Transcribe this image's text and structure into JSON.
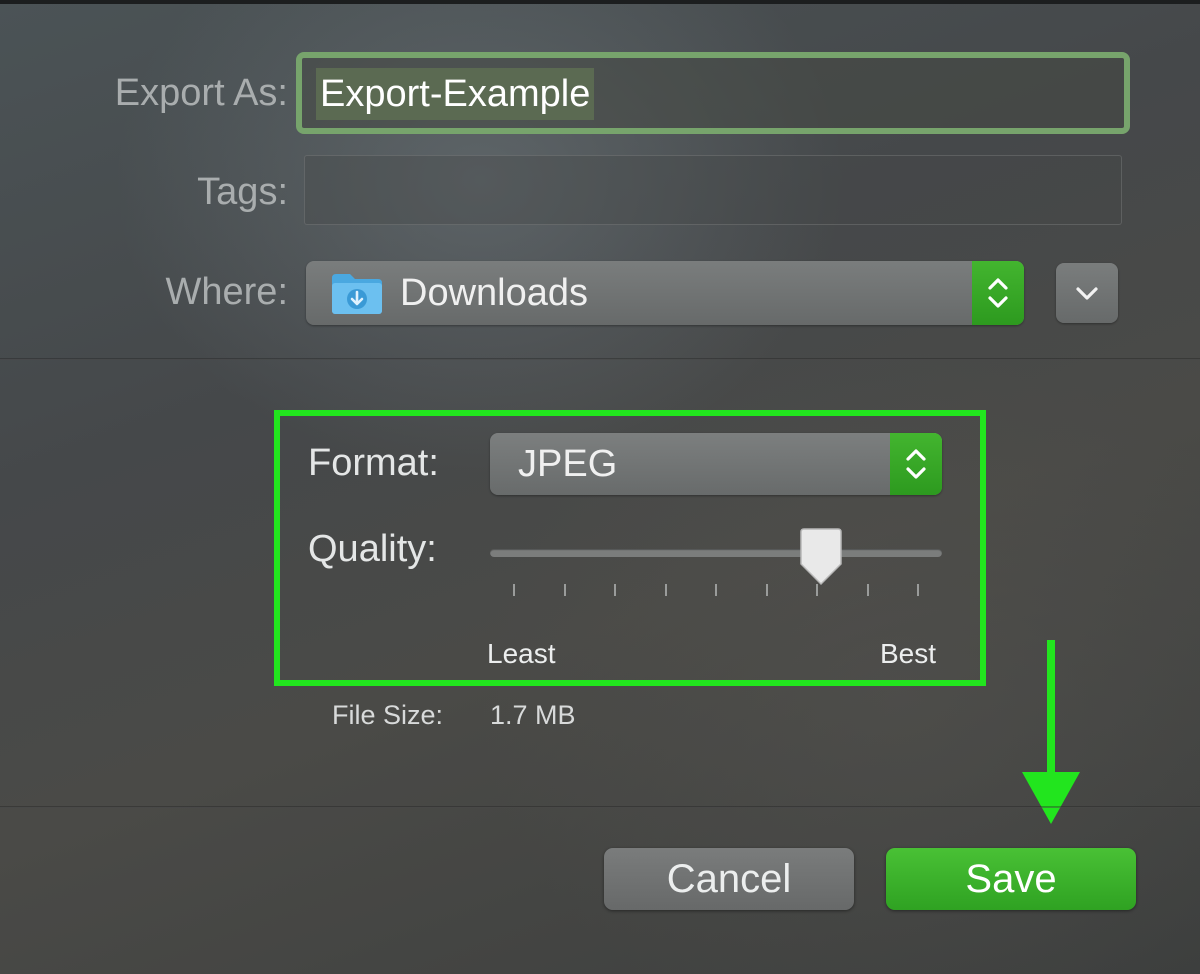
{
  "form": {
    "export_as_label": "Export As:",
    "export_as_value": "Export-Example",
    "tags_label": "Tags:",
    "tags_value": "",
    "where_label": "Where:",
    "where_value": "Downloads",
    "where_icon": "downloads-folder-icon"
  },
  "options": {
    "format_label": "Format:",
    "format_value": "JPEG",
    "quality_label": "Quality:",
    "quality_fraction": 0.76,
    "quality_tick_count": 9,
    "quality_min_label": "Least",
    "quality_max_label": "Best",
    "file_size_label": "File Size:",
    "file_size_value": "1.7 MB"
  },
  "buttons": {
    "cancel_label": "Cancel",
    "save_label": "Save"
  },
  "colors": {
    "accent": "#35ad26",
    "highlight": "#22e51e",
    "focus_ring": "#77a46c"
  }
}
